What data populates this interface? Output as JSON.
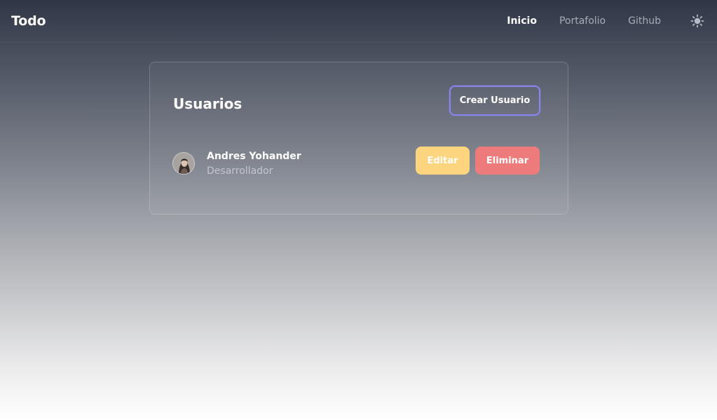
{
  "navbar": {
    "brand": "Todo",
    "links": [
      {
        "label": "Inicio",
        "active": true
      },
      {
        "label": "Portafolio",
        "active": false
      },
      {
        "label": "Github",
        "active": false
      }
    ],
    "theme_icon": "sun-icon"
  },
  "users_card": {
    "title": "Usuarios",
    "create_button": "Crear Usuario",
    "users": [
      {
        "name": "Andres Yohander",
        "role": "Desarrollador",
        "avatar": "avatar-photo",
        "edit_button": "Editar",
        "delete_button": "Eliminar"
      }
    ]
  },
  "colors": {
    "create_border": "#8b84ee",
    "edit": "#fcd57e",
    "delete": "#ee7b7b"
  }
}
